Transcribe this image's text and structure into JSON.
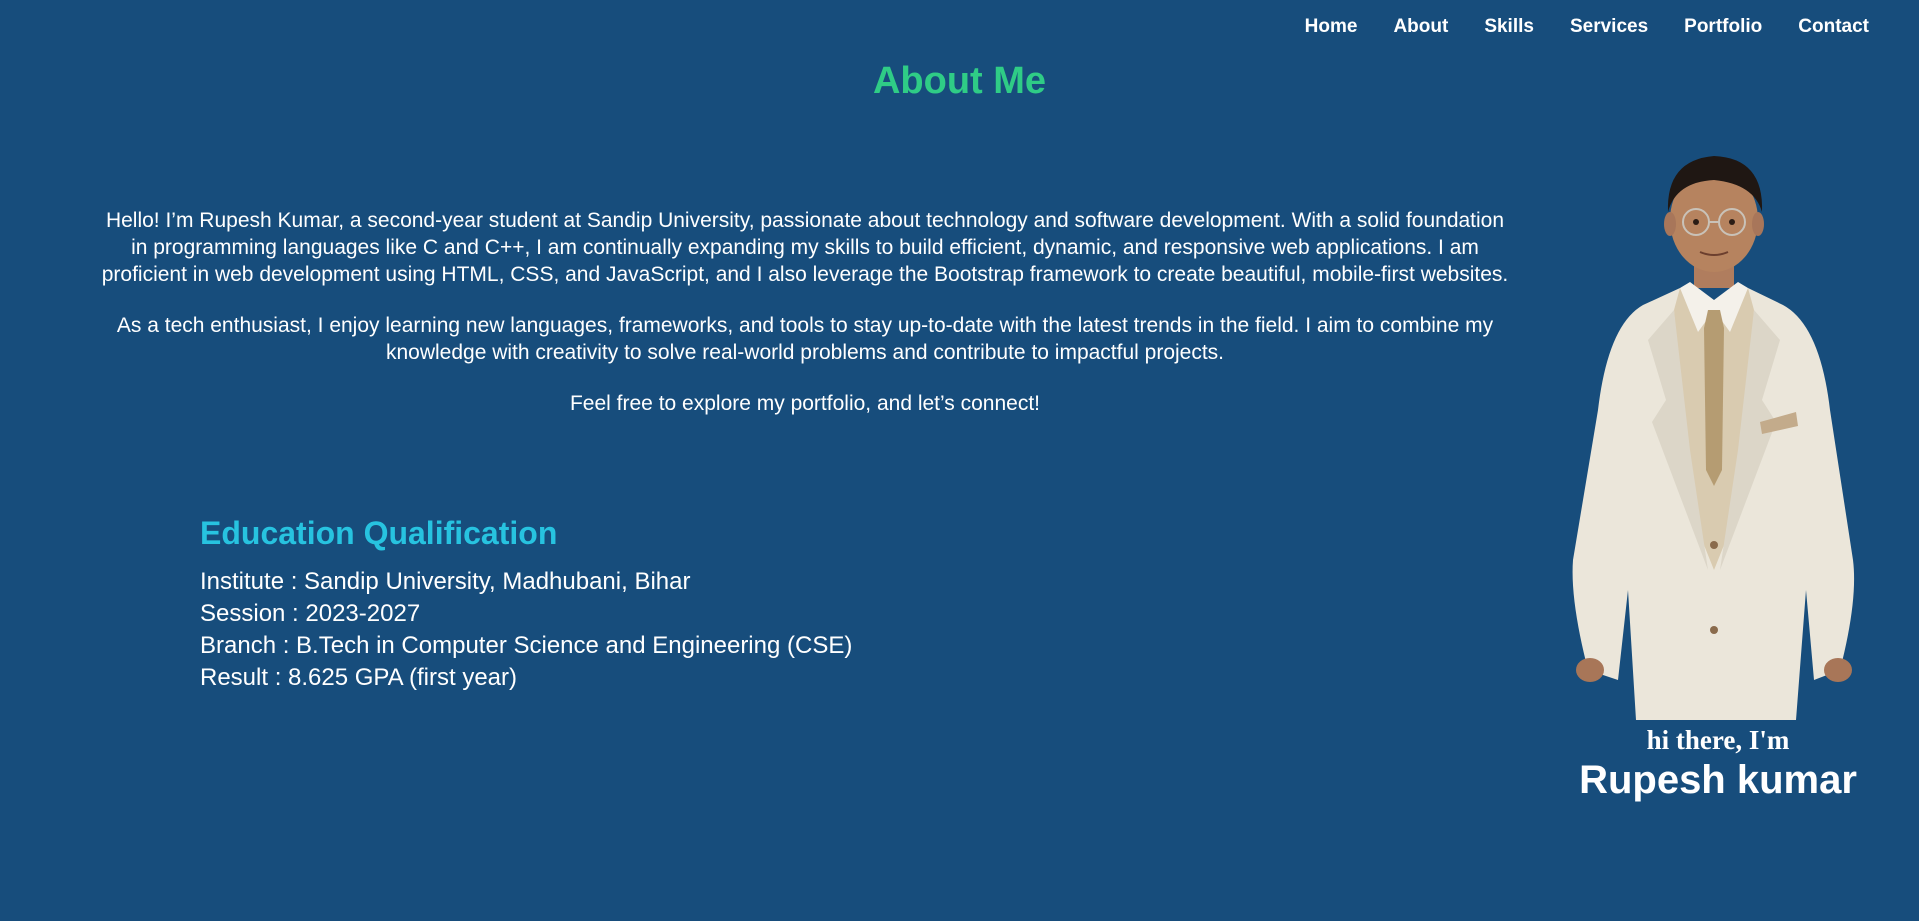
{
  "nav": {
    "items": [
      {
        "label": "Home"
      },
      {
        "label": "About"
      },
      {
        "label": "Skills"
      },
      {
        "label": "Services"
      },
      {
        "label": "Portfolio"
      },
      {
        "label": "Contact"
      }
    ]
  },
  "about": {
    "title": "About Me",
    "paragraphs": [
      "Hello! I’m Rupesh Kumar, a second-year student at Sandip University, passionate about technology and software development. With a solid foundation in programming languages like C and C++, I am continually expanding my skills to build efficient, dynamic, and responsive web applications. I am proficient in web development using HTML, CSS, and JavaScript, and I also leverage the Bootstrap framework to create beautiful, mobile-first websites.",
      "As a tech enthusiast, I enjoy learning new languages, frameworks, and tools to stay up-to-date with the latest trends in the field. I aim to combine my knowledge with creativity to solve real-world problems and contribute to impactful projects.",
      "Feel free to explore my portfolio, and let’s connect!"
    ]
  },
  "education": {
    "title": "Education Qualification",
    "rows": [
      "Institute : Sandip University, Madhubani, Bihar",
      "Session : 2023-2027",
      "Branch : B.Tech in Computer Science and Engineering (CSE)",
      "Result : 8.625 GPA (first year)"
    ]
  },
  "profile": {
    "greeting": "hi there, I'm",
    "name": "Rupesh kumar"
  },
  "colors": {
    "background": "#174d7c",
    "about_title": "#2fcc86",
    "education_title": "#27c3e0",
    "text": "#ffffff"
  }
}
